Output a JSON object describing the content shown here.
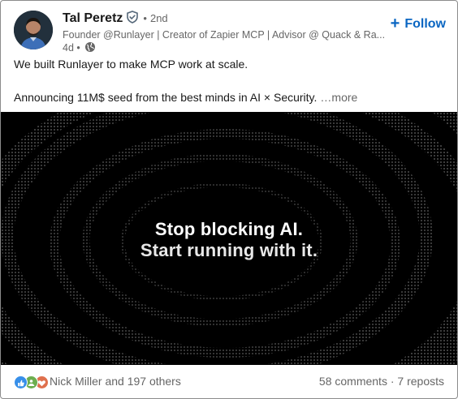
{
  "author": {
    "name": "Tal Peretz",
    "degree": "2nd",
    "headline": "Founder @Runlayer | Creator of Zapier MCP | Advisor @ Quack & Ra...",
    "time": "4d",
    "verified_icon": "shield-check-icon",
    "visibility_icon": "globe-icon"
  },
  "follow_label": "Follow",
  "post": {
    "line1": "We built Runlayer to make MCP work at scale.",
    "line2": "Announcing 11M$ seed from the best minds in AI × Security.",
    "more_label": "…more"
  },
  "media": {
    "line1": "Stop blocking AI.",
    "line2": "Start running with it."
  },
  "social": {
    "reaction_icons": [
      "like-icon",
      "support-icon",
      "love-icon"
    ],
    "reactors": "Nick Miller and 197 others",
    "comments": "58 comments",
    "separator": "·",
    "reposts": "7 reposts"
  },
  "colors": {
    "brand_blue": "#0a66c2",
    "muted_text": "#666666",
    "like": "#378fe9",
    "support": "#6dae4f",
    "love": "#df704d"
  }
}
